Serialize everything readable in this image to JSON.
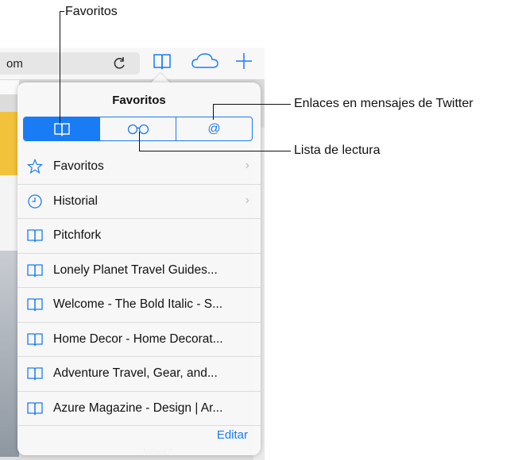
{
  "browser": {
    "url_fragment": "om",
    "peek_text": "Wool?"
  },
  "popover": {
    "title": "Favoritos",
    "segments": [
      {
        "icon": "book-icon",
        "label": "Favoritos",
        "active": true
      },
      {
        "icon": "glasses-icon",
        "label": "Lista de lectura",
        "active": false
      },
      {
        "icon": "at-icon",
        "symbol": "@",
        "label": "Enlaces en mensajes de Twitter",
        "active": false
      }
    ],
    "items": [
      {
        "icon": "star-icon",
        "label": "Favoritos",
        "chevron": true
      },
      {
        "icon": "clock-icon",
        "label": "Historial",
        "chevron": true
      },
      {
        "icon": "book-icon",
        "label": "Pitchfork",
        "chevron": false
      },
      {
        "icon": "book-icon",
        "label": "Lonely Planet Travel Guides...",
        "chevron": false
      },
      {
        "icon": "book-icon",
        "label": "Welcome - The Bold Italic - S...",
        "chevron": false
      },
      {
        "icon": "book-icon",
        "label": "Home Decor - Home Decorat...",
        "chevron": false
      },
      {
        "icon": "book-icon",
        "label": "Adventure Travel, Gear, and...",
        "chevron": false
      },
      {
        "icon": "book-icon",
        "label": "Azure Magazine - Design | Ar...",
        "chevron": false
      }
    ],
    "edit_label": "Editar"
  },
  "callouts": {
    "favorites": "Favoritos",
    "twitter_links": "Enlaces en mensajes de Twitter",
    "reading_list": "Lista de lectura"
  },
  "colors": {
    "accent": "#1a7cf5"
  }
}
